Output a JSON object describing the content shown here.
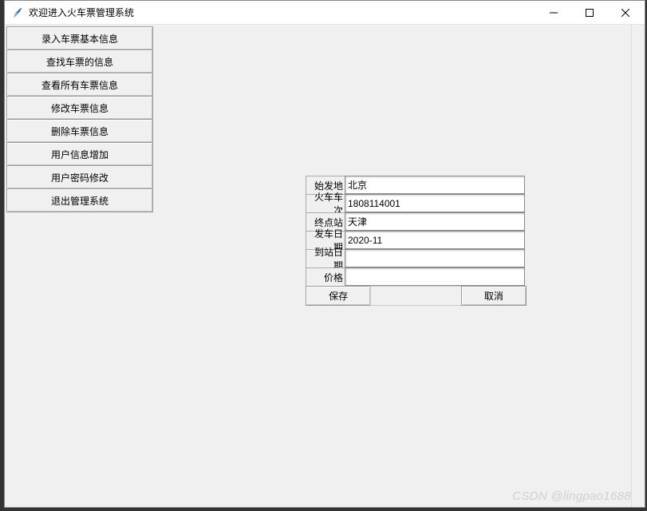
{
  "window": {
    "title": "欢迎进入火车票管理系统"
  },
  "sidebar": {
    "items": [
      {
        "label": "录入车票基本信息"
      },
      {
        "label": "查找车票的信息"
      },
      {
        "label": "查看所有车票信息"
      },
      {
        "label": "修改车票信息"
      },
      {
        "label": "删除车票信息"
      },
      {
        "label": "用户信息增加"
      },
      {
        "label": "用户密码修改"
      },
      {
        "label": "退出管理系统"
      }
    ]
  },
  "form": {
    "fields": {
      "origin": {
        "label": "始发地",
        "value": "北京"
      },
      "train_number": {
        "label": "火车车次",
        "value": "1808114001"
      },
      "destination": {
        "label": "终点站",
        "value": "天津"
      },
      "depart_date": {
        "label": "发车日期",
        "value": "2020-11"
      },
      "arrive_date": {
        "label": "到站日期",
        "value": ""
      },
      "price": {
        "label": "价格",
        "value": ""
      }
    },
    "buttons": {
      "save": "保存",
      "cancel": "取消"
    }
  },
  "watermark": "CSDN @lingpao1688"
}
